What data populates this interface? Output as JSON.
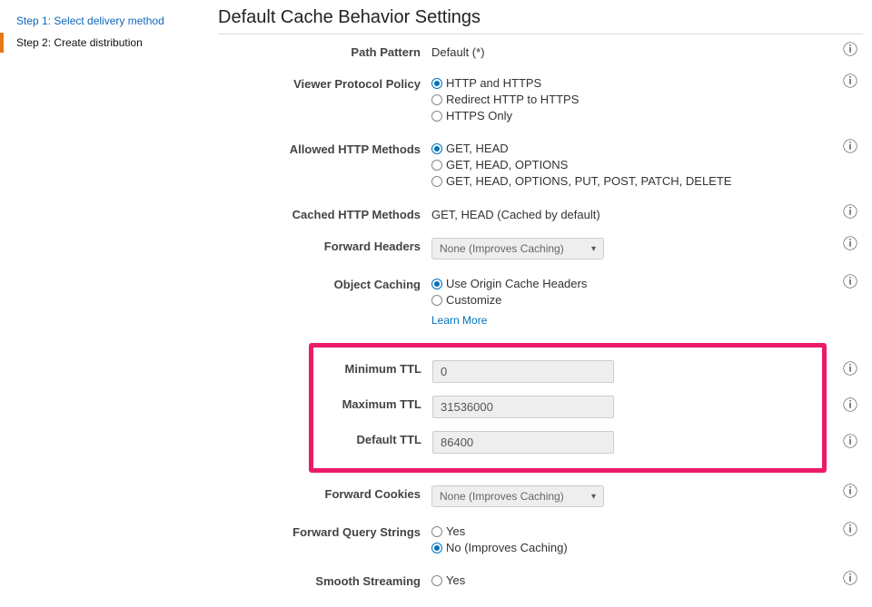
{
  "sidebar": {
    "steps": [
      {
        "label": "Step 1: Select delivery method",
        "active": false
      },
      {
        "label": "Step 2: Create distribution",
        "active": true
      }
    ]
  },
  "section": {
    "title": "Default Cache Behavior Settings"
  },
  "fields": {
    "path_pattern": {
      "label": "Path Pattern",
      "value": "Default (*)"
    },
    "viewer_protocol": {
      "label": "Viewer Protocol Policy",
      "options": [
        "HTTP and HTTPS",
        "Redirect HTTP to HTTPS",
        "HTTPS Only"
      ],
      "selected": 0
    },
    "allowed_methods": {
      "label": "Allowed HTTP Methods",
      "options": [
        "GET, HEAD",
        "GET, HEAD, OPTIONS",
        "GET, HEAD, OPTIONS, PUT, POST, PATCH, DELETE"
      ],
      "selected": 0
    },
    "cached_methods": {
      "label": "Cached HTTP Methods",
      "value": "GET, HEAD (Cached by default)"
    },
    "forward_headers": {
      "label": "Forward Headers",
      "value": "None (Improves Caching)"
    },
    "object_caching": {
      "label": "Object Caching",
      "options": [
        "Use Origin Cache Headers",
        "Customize"
      ],
      "selected": 0,
      "learn_more": "Learn More"
    },
    "min_ttl": {
      "label": "Minimum TTL",
      "value": "0"
    },
    "max_ttl": {
      "label": "Maximum TTL",
      "value": "31536000"
    },
    "default_ttl": {
      "label": "Default TTL",
      "value": "86400"
    },
    "forward_cookies": {
      "label": "Forward Cookies",
      "value": "None (Improves Caching)"
    },
    "forward_query": {
      "label": "Forward Query Strings",
      "options": [
        "Yes",
        "No (Improves Caching)"
      ],
      "selected": 1
    },
    "smooth_streaming": {
      "label": "Smooth Streaming",
      "options": [
        "Yes"
      ],
      "selected": -1
    }
  },
  "icons": {
    "info_glyph": "ℹ"
  }
}
